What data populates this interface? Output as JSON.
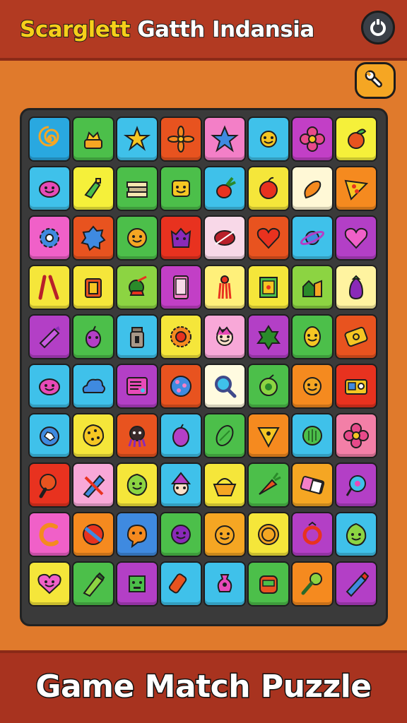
{
  "header": {
    "title_part1": "Scarglett",
    "title_part2": "Gatth Indansia",
    "power_icon": "power-icon",
    "tool_icon": "wrench-icon"
  },
  "footer": {
    "title": "Game Match Puzzle"
  },
  "palette": {
    "header_bg": "#b23a22",
    "board_bg": "#3a3a3a",
    "page_bg": "#e07a2c",
    "title_yellow": "#f6cf1a"
  },
  "board": {
    "rows": [
      [
        {
          "icon": "spiral",
          "bg": "#29a8e0"
        },
        {
          "icon": "cake",
          "bg": "#4cbf4a"
        },
        {
          "icon": "star-creature",
          "bg": "#3fc1ea"
        },
        {
          "icon": "leaf-flower",
          "bg": "#e8531f"
        },
        {
          "icon": "star",
          "bg": "#f37fc7"
        },
        {
          "icon": "sun-face",
          "bg": "#3fc1ea"
        },
        {
          "icon": "flower",
          "bg": "#c23fc6"
        },
        {
          "icon": "leaf-fruit",
          "bg": "#f5f03a"
        }
      ],
      [
        {
          "icon": "blob-face",
          "bg": "#3fc1ea"
        },
        {
          "icon": "bottle",
          "bg": "#f5f03a"
        },
        {
          "icon": "books",
          "bg": "#4cbf4a"
        },
        {
          "icon": "box-face",
          "bg": "#4cbf4a"
        },
        {
          "icon": "radish",
          "bg": "#3fc1ea"
        },
        {
          "icon": "apple",
          "bg": "#f5e63a"
        },
        {
          "icon": "pepper",
          "bg": "#fff8d6"
        },
        {
          "icon": "pizza",
          "bg": "#f58a1f"
        }
      ],
      [
        {
          "icon": "gear",
          "bg": "#f060c8"
        },
        {
          "icon": "badge",
          "bg": "#e8531f"
        },
        {
          "icon": "cookie-face",
          "bg": "#4cbf4a"
        },
        {
          "icon": "monster",
          "bg": "#e8321f"
        },
        {
          "icon": "feather",
          "bg": "#f8d8e8"
        },
        {
          "icon": "heart",
          "bg": "#e8531f"
        },
        {
          "icon": "planet",
          "bg": "#3fc1ea"
        },
        {
          "icon": "heart",
          "bg": "#b33fc6"
        }
      ],
      [
        {
          "icon": "chopsticks",
          "bg": "#f5e63a"
        },
        {
          "icon": "lantern",
          "bg": "#f5e63a"
        },
        {
          "icon": "pot",
          "bg": "#8cd442"
        },
        {
          "icon": "phone",
          "bg": "#c23fc6"
        },
        {
          "icon": "tassel",
          "bg": "#fff07a"
        },
        {
          "icon": "book",
          "bg": "#f5e63a"
        },
        {
          "icon": "house",
          "bg": "#8cd442"
        },
        {
          "icon": "eggplant",
          "bg": "#fff3a0"
        }
      ],
      [
        {
          "icon": "crayon",
          "bg": "#b33fc6"
        },
        {
          "icon": "berry",
          "bg": "#4cbf4a"
        },
        {
          "icon": "jar",
          "bg": "#3fc1ea"
        },
        {
          "icon": "ring",
          "bg": "#f5e63a"
        },
        {
          "icon": "face",
          "bg": "#f8a8d8"
        },
        {
          "icon": "leaf",
          "bg": "#b33fc6"
        },
        {
          "icon": "lemon",
          "bg": "#4cbf4a"
        },
        {
          "icon": "ticket",
          "bg": "#e8531f"
        }
      ],
      [
        {
          "icon": "blob-face",
          "bg": "#3fc1ea"
        },
        {
          "icon": "cloud",
          "bg": "#3fc1ea"
        },
        {
          "icon": "card",
          "bg": "#b33fc6"
        },
        {
          "icon": "dots",
          "bg": "#e8531f"
        },
        {
          "icon": "magnifier",
          "bg": "#fffbe0"
        },
        {
          "icon": "lime",
          "bg": "#4cbf4a"
        },
        {
          "icon": "orange-face",
          "bg": "#f58a1f"
        },
        {
          "icon": "radio",
          "bg": "#e8321f"
        }
      ],
      [
        {
          "icon": "bug",
          "bg": "#3fc1ea"
        },
        {
          "icon": "cookie",
          "bg": "#f5e63a"
        },
        {
          "icon": "spider",
          "bg": "#e8531f"
        },
        {
          "icon": "plum",
          "bg": "#3fc1ea"
        },
        {
          "icon": "seed",
          "bg": "#4cbf4a"
        },
        {
          "icon": "nacho",
          "bg": "#f58a1f"
        },
        {
          "icon": "melon",
          "bg": "#3fc1ea"
        },
        {
          "icon": "flower",
          "bg": "#f37fa7"
        }
      ],
      [
        {
          "icon": "paddle",
          "bg": "#e8321f"
        },
        {
          "icon": "pen",
          "bg": "#f8a8d8"
        },
        {
          "icon": "leaf-badge",
          "bg": "#f5e63a"
        },
        {
          "icon": "elf",
          "bg": "#3fc1ea"
        },
        {
          "icon": "basket",
          "bg": "#f5e63a"
        },
        {
          "icon": "carrot",
          "bg": "#4cbf4a"
        },
        {
          "icon": "eraser",
          "bg": "#f5a623"
        },
        {
          "icon": "yoyo",
          "bg": "#b33fc6"
        }
      ],
      [
        {
          "icon": "letter-c",
          "bg": "#f060c8"
        },
        {
          "icon": "ball",
          "bg": "#f58a1f"
        },
        {
          "icon": "bubble",
          "bg": "#3f8ae0"
        },
        {
          "icon": "grape-face",
          "bg": "#4cbf4a"
        },
        {
          "icon": "orange",
          "bg": "#f5a623"
        },
        {
          "icon": "coin",
          "bg": "#f5e63a"
        },
        {
          "icon": "ring2",
          "bg": "#b33fc6"
        },
        {
          "icon": "lime-face",
          "bg": "#3fc1ea"
        }
      ],
      [
        {
          "icon": "heart-face",
          "bg": "#f5e63a"
        },
        {
          "icon": "marker",
          "bg": "#4cbf4a"
        },
        {
          "icon": "block",
          "bg": "#b33fc6"
        },
        {
          "icon": "tube",
          "bg": "#3fc1ea"
        },
        {
          "icon": "vase",
          "bg": "#3fc1ea"
        },
        {
          "icon": "robot",
          "bg": "#4cbf4a"
        },
        {
          "icon": "bulb",
          "bg": "#f58a1f"
        },
        {
          "icon": "pencil",
          "bg": "#b33fc6"
        }
      ]
    ]
  }
}
